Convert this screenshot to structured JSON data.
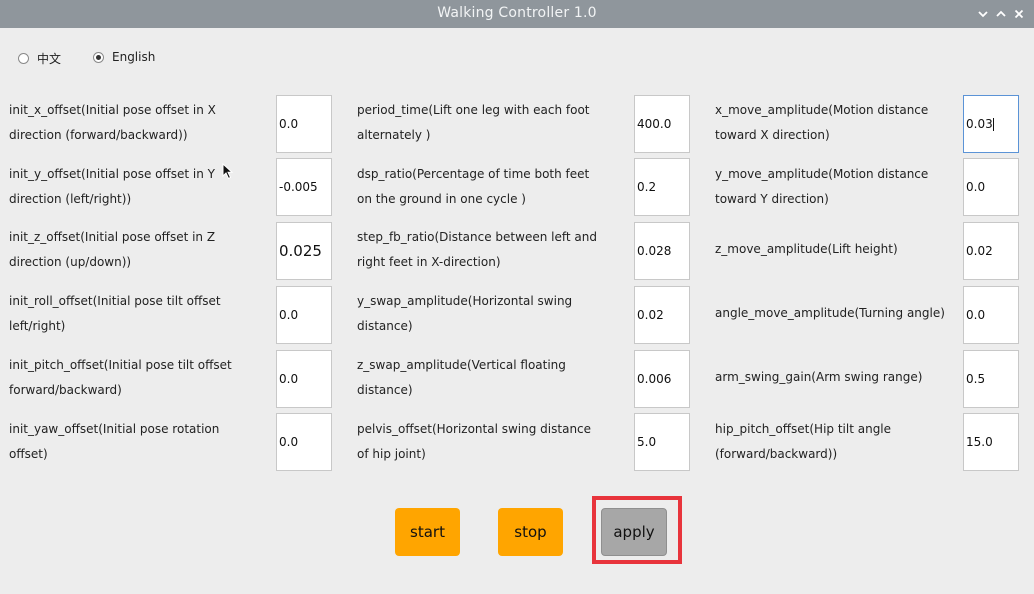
{
  "window": {
    "title": "Walking Controller 1.0",
    "controls": [
      "chevron-down-icon",
      "chevron-up-icon",
      "close-icon"
    ]
  },
  "language": {
    "options": [
      {
        "label": "中文",
        "selected": false
      },
      {
        "label": "English",
        "selected": true
      }
    ]
  },
  "columns": [
    [
      {
        "label": "init_x_offset(Initial pose offset in X direction (forward/backward))",
        "value": "0.0"
      },
      {
        "label": "init_y_offset(Initial pose offset in Y direction (left/right))",
        "value": "-0.005"
      },
      {
        "label": "init_z_offset(Initial pose offset in Z direction (up/down))",
        "value": "0.025"
      },
      {
        "label": "init_roll_offset(Initial pose tilt offset left/right)",
        "value": "0.0"
      },
      {
        "label": "init_pitch_offset(Initial pose tilt offset forward/backward)",
        "value": "0.0"
      },
      {
        "label": "init_yaw_offset(Initial pose rotation offset)",
        "value": "0.0"
      }
    ],
    [
      {
        "label": "period_time(Lift one leg with each foot alternately )",
        "value": "400.0"
      },
      {
        "label": "dsp_ratio(Percentage of time both feet on the ground in one cycle )",
        "value": "0.2"
      },
      {
        "label": "step_fb_ratio(Distance between left and right feet in X-direction)",
        "value": "0.028"
      },
      {
        "label": "y_swap_amplitude(Horizontal swing distance)",
        "value": "0.02"
      },
      {
        "label": "z_swap_amplitude(Vertical floating distance)",
        "value": "0.006"
      },
      {
        "label": "pelvis_offset(Horizontal swing distance of hip joint)",
        "value": "5.0"
      }
    ],
    [
      {
        "label": "x_move_amplitude(Motion distance toward X direction)",
        "value": "0.03"
      },
      {
        "label": "y_move_amplitude(Motion distance toward Y direction)",
        "value": "0.0"
      },
      {
        "label": "z_move_amplitude(Lift height)",
        "value": "0.02"
      },
      {
        "label": "angle_move_amplitude(Turning angle)",
        "value": "0.0"
      },
      {
        "label": "arm_swing_gain(Arm swing range)",
        "value": "0.5"
      },
      {
        "label": "hip_pitch_offset(Hip tilt angle (forward/backward))",
        "value": "15.0"
      }
    ]
  ],
  "buttons": {
    "start": "start",
    "stop": "stop",
    "apply": "apply"
  },
  "colors": {
    "titlebar": "#8f969c",
    "background": "#ededed",
    "button_orange": "#ffa500",
    "button_gray": "#a7a7a7",
    "highlight": "#e8343c",
    "focus_border": "#5b93d6"
  }
}
